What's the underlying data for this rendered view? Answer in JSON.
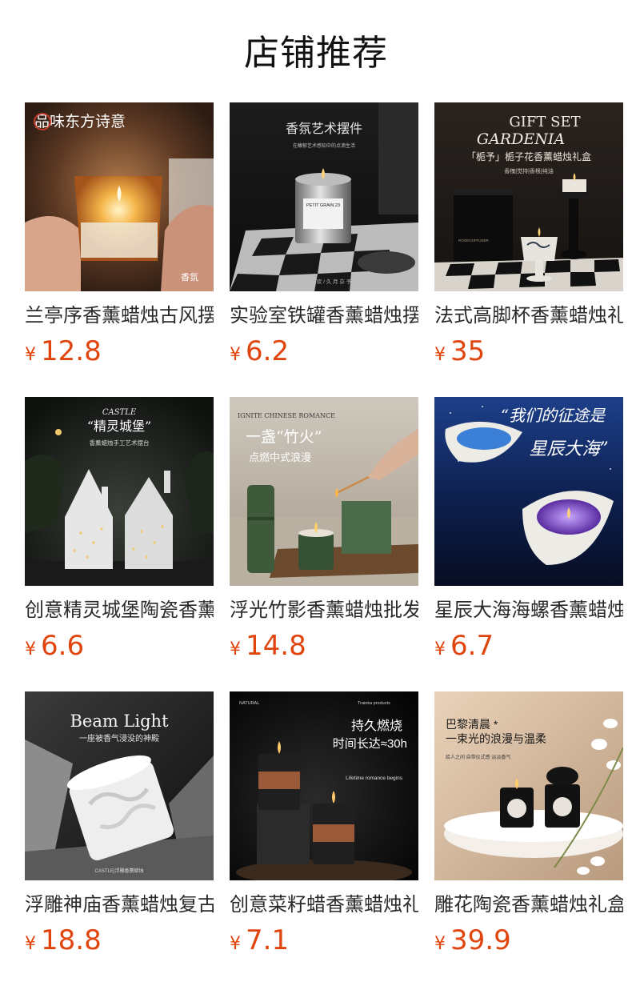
{
  "page": {
    "title": "店铺推荐"
  },
  "colors": {
    "price": "#e0450d",
    "title": "#111111",
    "name": "#2a2a2a"
  },
  "products": [
    {
      "name": "兰亭序香薰蜡烛古风摆件",
      "currency": "¥",
      "price": "12.8",
      "image_text": {
        "headline": "品味东方诗意",
        "corner": "香氛"
      }
    },
    {
      "name": "实验室铁罐香薰蜡烛摆件",
      "currency": "¥",
      "price": "6.2",
      "image_text": {
        "headline": "香氛艺术摆件",
        "sub": "在馥郁艺术感知中的点滴生活",
        "label": "PETIT GRAIN 23",
        "footer": "初 见 午 惊 欢 / 久 月 芬 予 欢"
      }
    },
    {
      "name": "法式高脚杯香薰蜡烛礼盒",
      "currency": "¥",
      "price": "35",
      "image_text": {
        "line1": "GIFT SET",
        "line2": "GARDENIA",
        "line3": "「栀予」栀子花香薰蜡烛礼盒",
        "line4": "香槐|觉持|香根|纯油",
        "box": "ROOM DIFFUSER"
      }
    },
    {
      "name": "创意精灵城堡陶瓷香薰蜡烛",
      "currency": "¥",
      "price": "6.6",
      "image_text": {
        "script": "CASTLE",
        "headline": "“精灵城堡”",
        "sub": "香薰蜡烛手工艺术摆台"
      }
    },
    {
      "name": "浮光竹影香薰蜡烛批发",
      "currency": "¥",
      "price": "14.8",
      "image_text": {
        "top": "IGNITE CHINESE ROMANCE",
        "headline": "一盏“竹火”",
        "sub": "点燃中式浪漫"
      }
    },
    {
      "name": "星辰大海海螺香薰蜡烛",
      "currency": "¥",
      "price": "6.7",
      "image_text": {
        "line1": "“我们的征途是",
        "line2": "星辰大海”"
      }
    },
    {
      "name": "浮雕神庙香薰蜡烛复古摆件",
      "currency": "¥",
      "price": "18.8",
      "image_text": {
        "headline": "Beam Light",
        "sub": "一座被香气浸没的神殿",
        "footer": "CASTLE|浮雕香薰蜡烛"
      }
    },
    {
      "name": "创意菜籽蜡香薰蜡烛礼盒",
      "currency": "¥",
      "price": "7.1",
      "image_text": {
        "line1": "持久燃烧",
        "line2": "时间长达≈30h",
        "side": "Lifetime romance begins",
        "top": "Trainka products"
      }
    },
    {
      "name": "雕花陶瓷香薰蜡烛礼盒",
      "currency": "¥",
      "price": "39.9",
      "image_text": {
        "line1": "巴黎清晨 *",
        "line2": "一束光的浪漫与温柔",
        "sub": "给人之间 自带仪式感 淡淡香气"
      }
    }
  ]
}
